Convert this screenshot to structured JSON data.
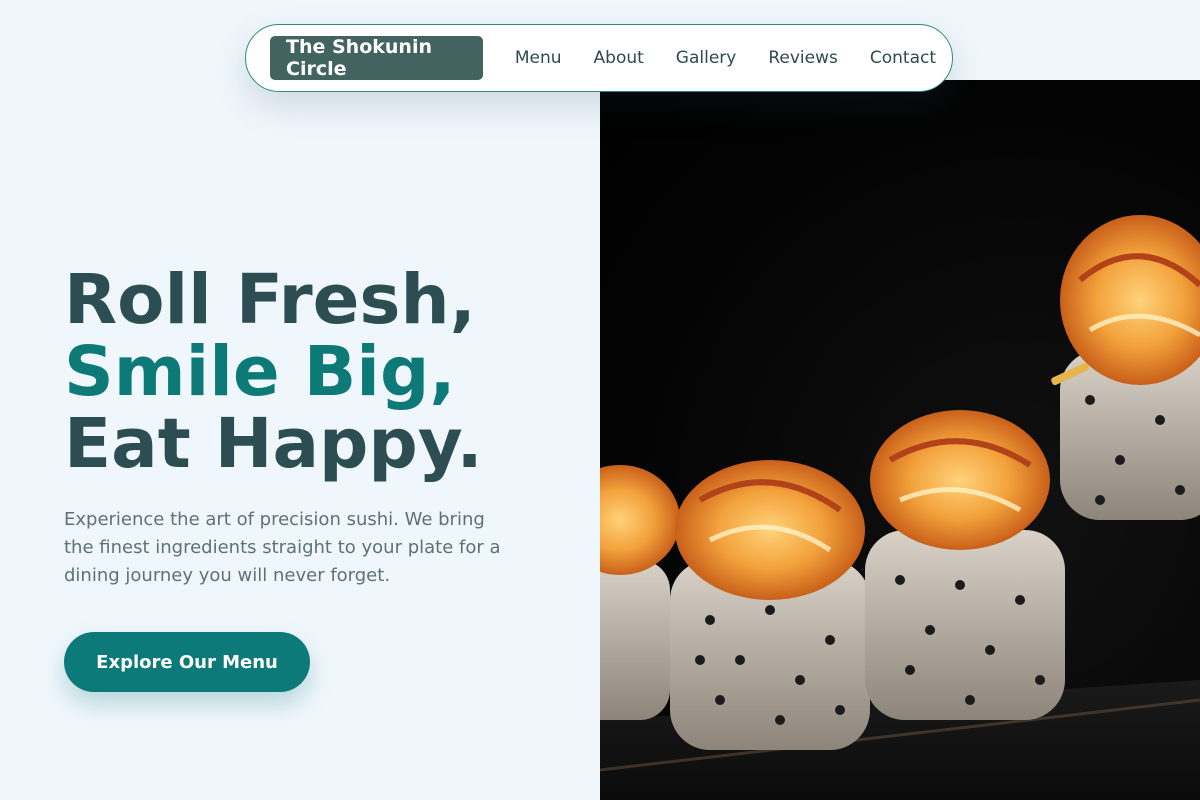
{
  "navbar": {
    "brand": "The Shokunin Circle",
    "links": [
      {
        "label": "Menu"
      },
      {
        "label": "About"
      },
      {
        "label": "Gallery"
      },
      {
        "label": "Reviews"
      },
      {
        "label": "Contact"
      }
    ]
  },
  "hero": {
    "headline": {
      "line1": "Roll Fresh,",
      "line2": "Smile Big,",
      "line3": "Eat Happy."
    },
    "description": "Experience the art of precision sushi. We bring the finest ingredients straight to your plate for a dining journey you will never forget.",
    "cta_label": "Explore Our Menu",
    "image_subject": "sushi-rolls-photo"
  },
  "colors": {
    "page_bg": "#f0f7fc",
    "brand_bg": "#436360",
    "accent": "#0e7a78",
    "headline": "#2c4e52",
    "body_text": "#5e7174"
  }
}
